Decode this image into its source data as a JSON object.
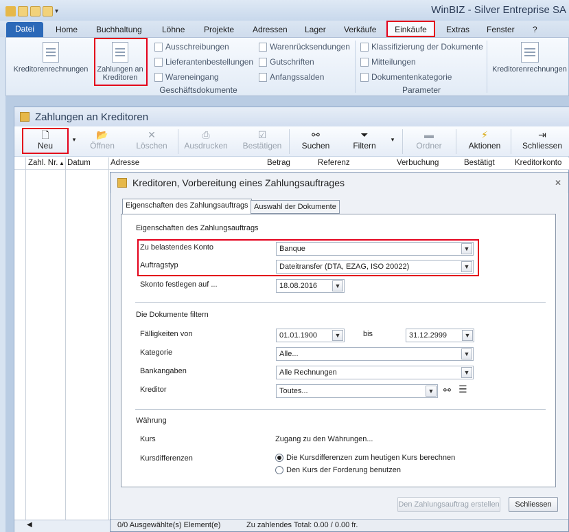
{
  "app": {
    "title": "WinBIZ - Silver Entreprise SA"
  },
  "menu": {
    "tabs": [
      "Datei",
      "Home",
      "Buchhaltung",
      "Löhne",
      "Projekte",
      "Adressen",
      "Lager",
      "Verkäufe",
      "Einkäufe",
      "Extras",
      "Fenster",
      "?"
    ],
    "active": "Einkäufe"
  },
  "ribbon": {
    "kreditorenrechnungen": "Kreditorenrechnungen",
    "zahlungen_line1": "Zahlungen an",
    "zahlungen_line2": "Kreditoren",
    "col1": [
      "Ausschreibungen",
      "Lieferantenbestellungen",
      "Wareneingang"
    ],
    "col2": [
      "Warenrücksendungen",
      "Gutschriften",
      "Anfangssalden"
    ],
    "group_docs": "Geschäftsdokumente",
    "param": [
      "Klassifizierung der Dokumente",
      "Mitteilungen",
      "Dokumentenkategorie"
    ],
    "group_param": "Parameter",
    "kreditorenrechnungen2": "Kreditorenrechnungen"
  },
  "window": {
    "title": "Zahlungen an Kreditoren"
  },
  "toolbar": {
    "neu": "Neu",
    "oeffnen": "Öffnen",
    "loeschen": "Löschen",
    "ausdrucken": "Ausdrucken",
    "bestaetigen": "Bestätigen",
    "suchen": "Suchen",
    "filtern": "Filtern",
    "ordner": "Ordner",
    "aktionen": "Aktionen",
    "schliessen": "Schliessen"
  },
  "grid": {
    "columns": [
      "Zahl. Nr.",
      "Datum",
      "Adresse",
      "Betrag",
      "Referenz",
      "Verbuchung",
      "Bestätigt",
      "Kreditorkonto"
    ]
  },
  "dialog": {
    "title": "Kreditoren, Vorbereitung eines Zahlungsauftrages",
    "tabs": [
      "Eigenschaften des Zahlungsauftrags",
      "Auswahl der Dokumente"
    ],
    "section1": "Eigenschaften des Zahlungsauftrags",
    "konto_label": "Zu belastendes Konto",
    "konto_value": "Banque",
    "typ_label": "Auftragstyp",
    "typ_value": "Dateitransfer (DTA, EZAG, ISO 20022)",
    "skonto_label": "Skonto festlegen auf ...",
    "skonto_value": "18.08.2016",
    "section2": "Die Dokumente filtern",
    "faellig_label": "Fälligkeiten von",
    "faellig_from": "01.01.1900",
    "bis": "bis",
    "faellig_to": "31.12.2999",
    "kategorie_label": "Kategorie",
    "kategorie_value": "Alle...",
    "bank_label": "Bankangaben",
    "bank_value": "Alle Rechnungen",
    "kreditor_label": "Kreditor",
    "kreditor_value": "Toutes...",
    "section3": "Währung",
    "kurs_label": "Kurs",
    "kurs_value": "Zugang zu den Währungen...",
    "kursdiff_label": "Kursdifferenzen",
    "radio1": "Die Kursdifferenzen zum heutigen Kurs berechnen",
    "radio2": "Den Kurs der Forderung benutzen",
    "btn_create": "Den Zahlungsauftrag erstellen",
    "btn_close": "Schliessen",
    "status_sel": "0/0 Ausgewählte(s) Element(e)",
    "status_total": "Zu zahlendes Total: 0.00 / 0.00  fr."
  },
  "colors": {
    "accent": "#2b69b8",
    "highlight": "#e3001b"
  }
}
